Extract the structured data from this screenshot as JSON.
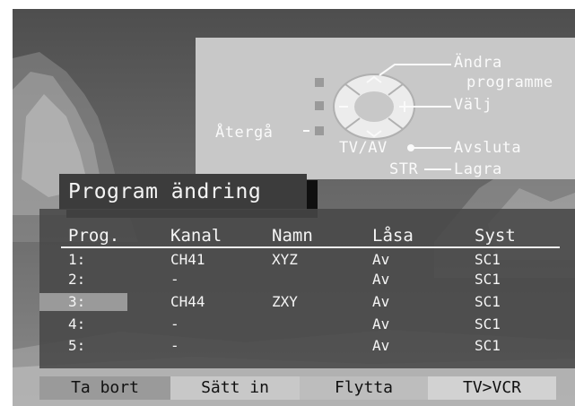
{
  "help": {
    "labels": {
      "change": "Ändra",
      "program": "programme",
      "select": "Välj",
      "back": "Återgå",
      "tvav": "TV/AV",
      "quit": "Avsluta",
      "str": "STR",
      "store": "Lagra"
    }
  },
  "title": "Program ändring",
  "table": {
    "headers": [
      "Prog.",
      "Kanal",
      "Namn",
      "Låsa",
      "Syst"
    ],
    "rows": [
      [
        "1:",
        "CH41",
        "XYZ",
        "Av",
        "SC1"
      ],
      [
        "2:",
        "-",
        "",
        "Av",
        "SC1"
      ],
      [
        "3:",
        "CH44",
        "ZXY",
        "Av",
        "SC1"
      ],
      [
        "4:",
        "-",
        "",
        "Av",
        "SC1"
      ],
      [
        "5:",
        "-",
        "",
        "Av",
        "SC1"
      ]
    ],
    "selected_row": 3
  },
  "buttons": {
    "delete": "Ta bort",
    "insert": "Sätt in",
    "move": "Flytta",
    "tvvcr": "TV>VCR"
  },
  "colors": {
    "red_button": "#9a9a9a",
    "green_button": "#c8c8c8",
    "yellow_button": "#bdbdbd",
    "blue_button": "#d2d2d2"
  }
}
